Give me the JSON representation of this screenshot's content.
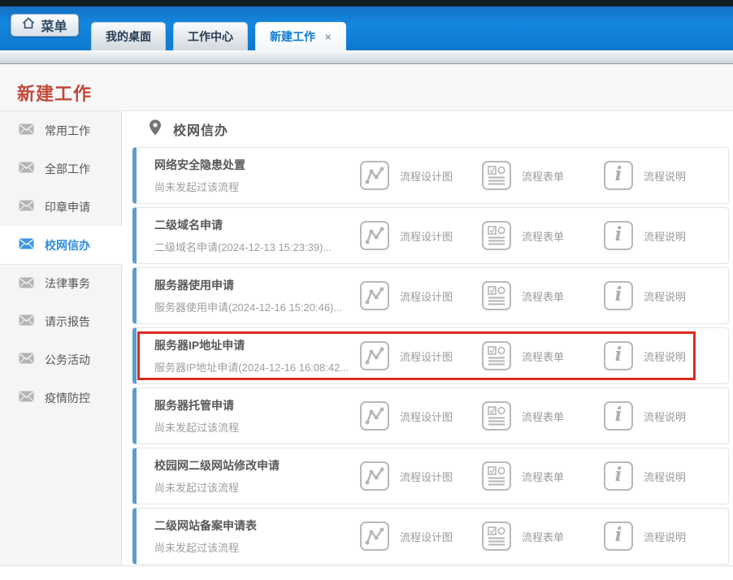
{
  "header": {
    "menu_button_label": "菜单",
    "close_glyph": "×",
    "tabs": [
      {
        "label": "我的桌面"
      },
      {
        "label": "工作中心"
      },
      {
        "label": "新建工作",
        "active": true,
        "closable": true
      }
    ]
  },
  "page_title": "新建工作",
  "sidebar": {
    "items": [
      {
        "label": "常用工作"
      },
      {
        "label": "全部工作"
      },
      {
        "label": "印章申请"
      },
      {
        "label": "校网信办",
        "active": true
      },
      {
        "label": "法律事务"
      },
      {
        "label": "请示报告"
      },
      {
        "label": "公务活动"
      },
      {
        "label": "疫情防控"
      }
    ]
  },
  "content": {
    "section_title": "校网信办",
    "actions": [
      {
        "label": "流程设计图",
        "icon": "chart-icon"
      },
      {
        "label": "流程表单",
        "icon": "form-icon"
      },
      {
        "label": "流程说明",
        "icon": "info-icon"
      }
    ],
    "rows": [
      {
        "title": "网络安全隐患处置",
        "subtitle": "尚未发起过该流程"
      },
      {
        "title": "二级域名申请",
        "subtitle": "二级域名申请(2024-12-13 15:23:39)..."
      },
      {
        "title": "服务器使用申请",
        "subtitle": "服务器使用申请(2024-12-16 15:20:46)..."
      },
      {
        "title": "服务器IP地址申请",
        "subtitle": "服务器IP地址申请(2024-12-16 16:08:42...",
        "highlighted": true
      },
      {
        "title": "服务器托管申请",
        "subtitle": "尚未发起过该流程"
      },
      {
        "title": "校园网二级网站修改申请",
        "subtitle": "尚未发起过该流程"
      },
      {
        "title": "二级网站备案申请表",
        "subtitle": "尚未发起过该流程"
      }
    ]
  },
  "colors": {
    "header_blue": "#1487de",
    "active_tab_text": "#0d7bd3",
    "page_title_red": "#c04a38",
    "card_accent_blue": "#5d9ccd",
    "highlight_red": "#db2a1f",
    "sidebar_active_blue": "#2e8ede"
  }
}
